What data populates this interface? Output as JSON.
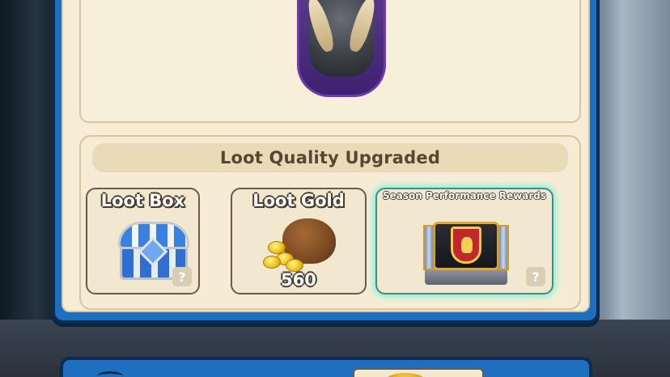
{
  "upgrade_section": {
    "title": "Loot Quality Upgraded"
  },
  "rewards": [
    {
      "label": "Loot Box",
      "icon": "loot-box-chest-icon",
      "help": "?"
    },
    {
      "label": "Loot Gold",
      "icon": "gold-bag-icon",
      "amount": "560"
    },
    {
      "label": "Season Performance Rewards",
      "icon": "season-chest-icon",
      "help": "?",
      "highlighted": true
    }
  ],
  "colors": {
    "panel_blue": "#1f6fc0",
    "panel_border": "#0e2c4d",
    "parchment": "#f7ecd5",
    "highlight_glow": "#8ef0d8"
  }
}
